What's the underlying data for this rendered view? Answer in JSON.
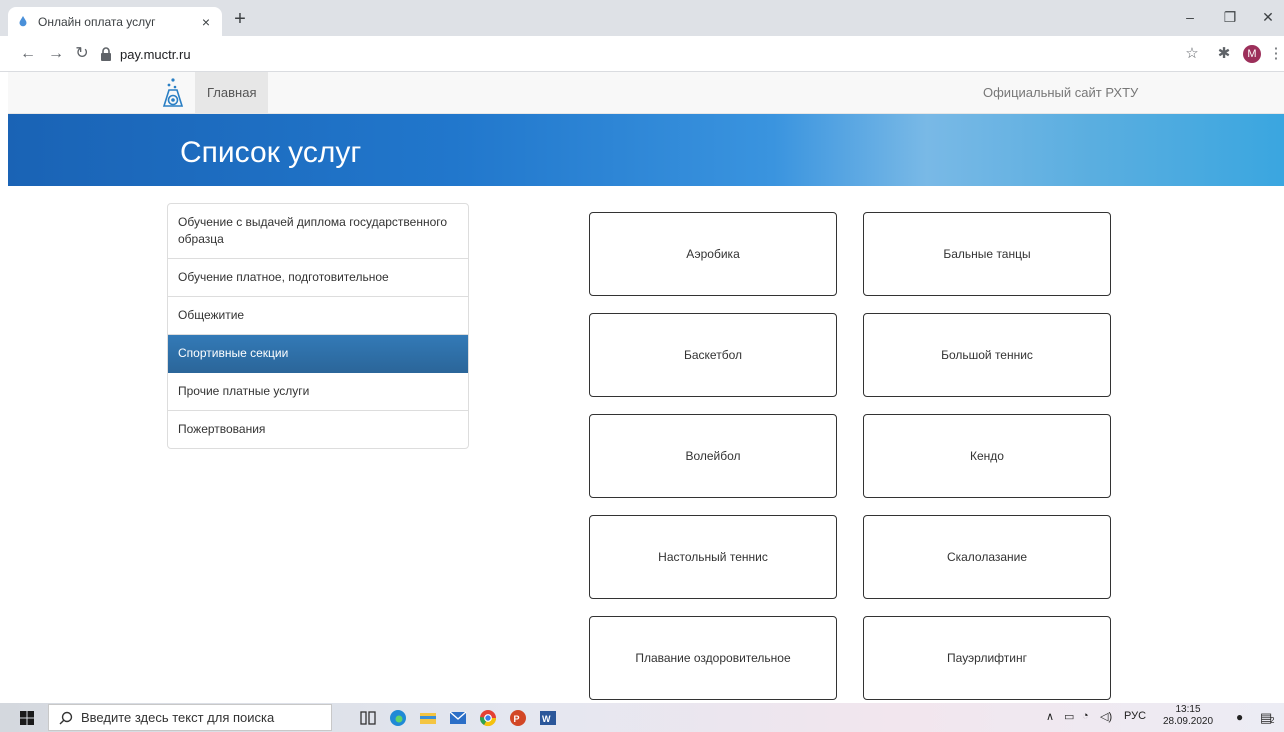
{
  "browser": {
    "tab_title": "Онлайн оплата услуг",
    "tab_close": "×",
    "new_tab": "+",
    "url": "pay.muctr.ru",
    "profile_initial": "M"
  },
  "site_nav": {
    "home": "Главная",
    "official_site": "Официальный сайт РХТУ"
  },
  "hero": {
    "title": "Список услуг"
  },
  "categories": [
    "Обучение с выдачей диплома государственного образца",
    "Обучение платное, подготовительное",
    "Общежитие",
    "Спортивные секции",
    "Прочие платные услуги",
    "Пожертвования"
  ],
  "active_category": "Спортивные секции",
  "services": [
    "Аэробика",
    "Бальные танцы",
    "Баскетбол",
    "Большой теннис",
    "Волейбол",
    "Кендо",
    "Настольный теннис",
    "Скалолазание",
    "Плавание оздоровительное",
    "Пауэрлифтинг"
  ],
  "taskbar": {
    "search_placeholder": "Введите здесь текст для поиска",
    "language": "РУС",
    "time": "13:15",
    "date": "28.09.2020",
    "notification_count": "2"
  },
  "colors": {
    "active_category_bg": "#337ab7",
    "hero_gradient_start": "#1a63b5",
    "hero_gradient_end": "#3aa6e0"
  }
}
